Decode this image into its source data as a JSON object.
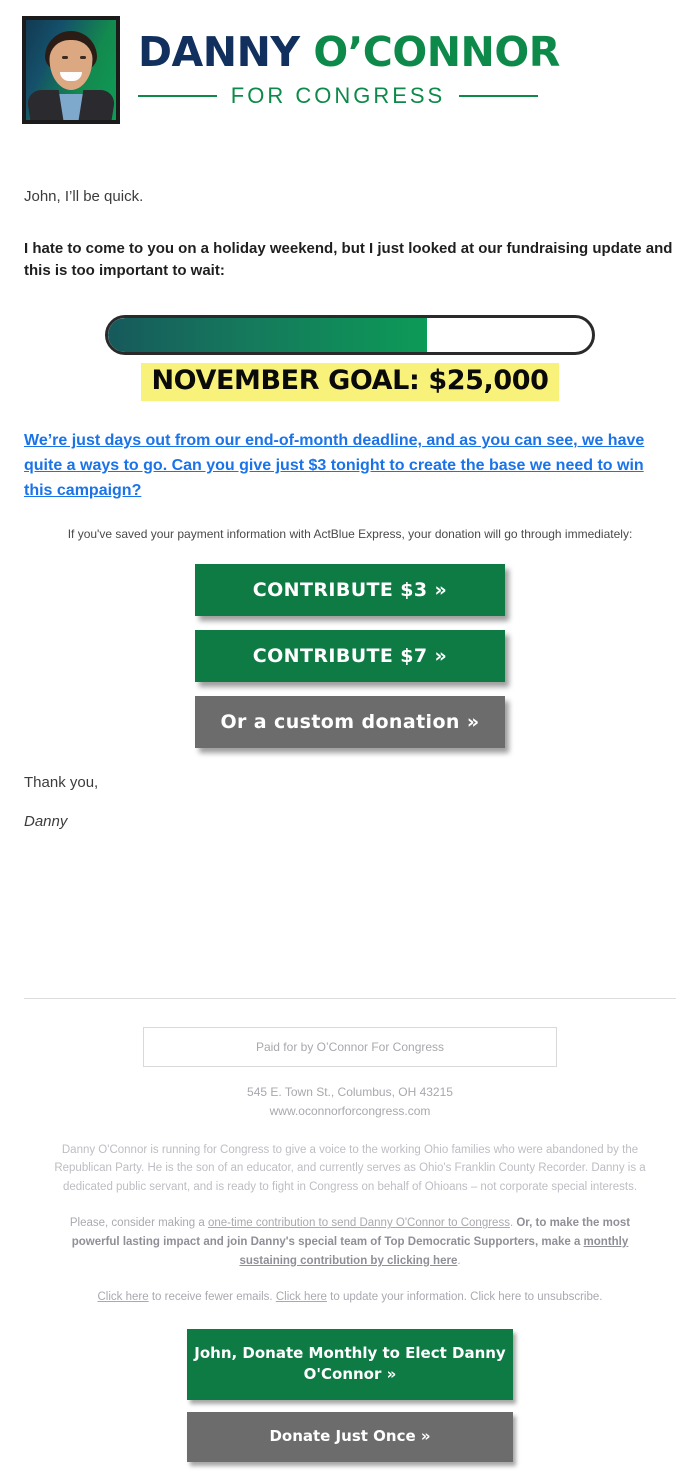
{
  "header": {
    "avatar_alt": "Danny O'Connor headshot",
    "logo_name_first": "DANNY ",
    "logo_name_last": "O’CONNOR",
    "logo_subtitle": "FOR CONGRESS",
    "colors": {
      "navy": "#12305e",
      "green": "#0d8a4a"
    }
  },
  "body": {
    "greeting": "John, I’ll be quick.",
    "lede": "I hate to come to you on a holiday weekend, but I just looked at our fundraising update and this is too important to wait:",
    "big_link": "We’re just days out from our end-of-month deadline, and as you can see, we have quite a ways to go. Can you give just $3 tonight to create the base we need to win this campaign?",
    "actblue_note": "If you've saved your payment information with ActBlue Express, your donation will go through immediately:",
    "signoff": "Thank you,",
    "signature": "Danny"
  },
  "progress": {
    "goal_label": "NOVEMBER GOAL: $25,000",
    "percent": 66,
    "fill_gradient_start": "#16595c",
    "fill_gradient_end": "#0c9a57",
    "banner_color": "#f9f27a"
  },
  "donate_buttons": [
    {
      "label": "CONTRIBUTE $3 »",
      "style": "green"
    },
    {
      "label": "CONTRIBUTE $7 »",
      "style": "green"
    },
    {
      "label": "Or a custom donation »",
      "style": "grey"
    }
  ],
  "footer": {
    "paid_for": "Paid for by O’Connor For Congress",
    "address": "545 E. Town St., Columbus, OH 43215",
    "website": "www.oconnorforcongress.com",
    "bio": "Danny O'Connor is running for Congress to give a voice to the working Ohio families who were abandoned by the Republican Party. He is the son of an educator, and currently serves as Ohio's Franklin County Recorder. Danny is a dedicated public servant, and is ready to fight in Congress on behalf of Ohioans – not corporate special interests.",
    "consider": {
      "part1": "Please, consider making a ",
      "link1": "one-time contribution to send Danny O'Connor to Congress",
      "part2": ". ",
      "bold1": "Or, to make the most powerful lasting impact and join Danny's special team of Top Democratic Supporters, make a ",
      "link2": "monthly sustaining contribution by clicking here",
      "part3": "."
    },
    "unsubscribe": {
      "link1": "Click here",
      "text1": " to receive fewer emails. ",
      "link2": "Click here",
      "text2": " to update your information. Click here to unsubscribe."
    },
    "buttons": [
      {
        "label": "John, Donate Monthly to Elect Danny O'Connor »",
        "style": "green"
      },
      {
        "label": "Donate Just Once »",
        "style": "grey"
      }
    ]
  }
}
